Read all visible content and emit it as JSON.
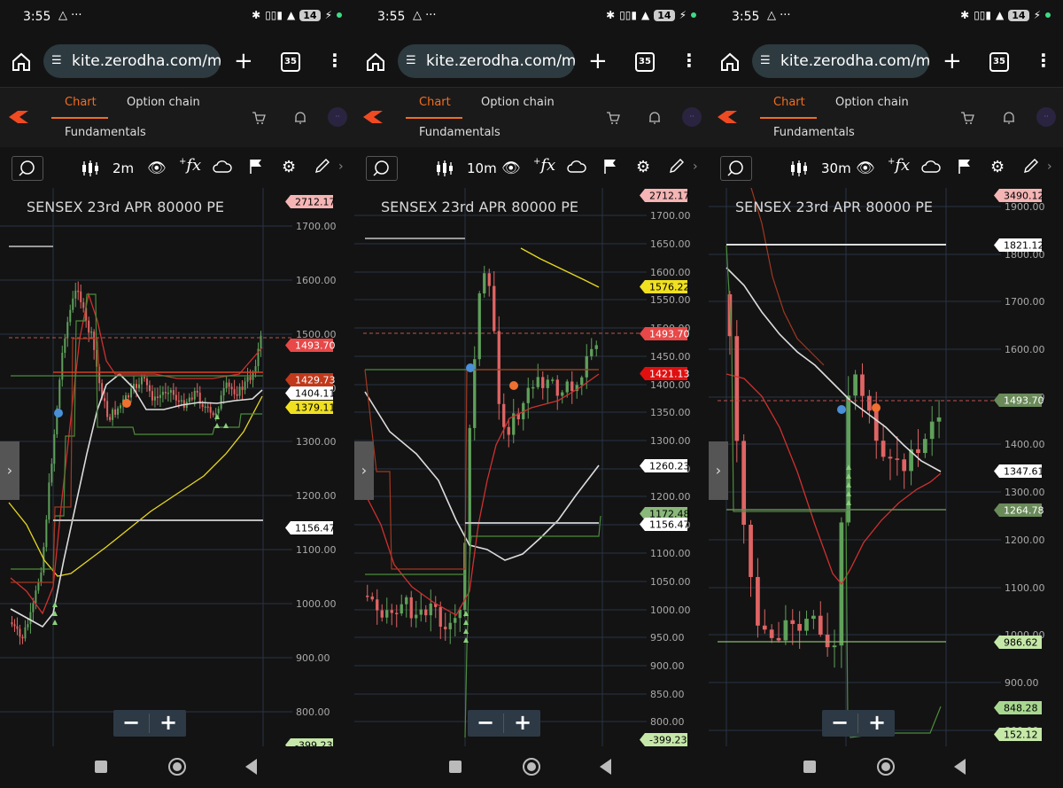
{
  "panels": [
    {
      "status": {
        "time": "3:55",
        "battery": "14"
      },
      "browser": {
        "url": "kite.zerodha.com/mar",
        "tab_count": "35"
      },
      "app_tabs": {
        "chart": "Chart",
        "option_chain": "Option chain",
        "fundamentals": "Fundamentals"
      },
      "avatar_text": "··",
      "toolbar": {
        "interval": "2m"
      },
      "chart_title": "SENSEX 23rd APR 80000 PE",
      "chart_data": {
        "type": "candlestick",
        "title": "SENSEX 23rd APR 80000 PE",
        "interval": "2m",
        "price_axis_ticks": [
          "1700.00",
          "1600.00",
          "1500.00",
          "1400.00",
          "1300.00",
          "1200.00",
          "1100.00",
          "1000.00",
          "900.00",
          "800.00"
        ],
        "price_tags": [
          {
            "label": "2712.17",
            "color": "#f5b5b5",
            "text_color": "#000"
          },
          {
            "label": "1493.70",
            "color": "#e84848",
            "text_color": "#fff"
          },
          {
            "label": "1429.73",
            "color": "#c0391b",
            "text_color": "#fff"
          },
          {
            "label": "1404.11",
            "color": "#ffffff",
            "text_color": "#000"
          },
          {
            "label": "1379.11",
            "color": "#f0e020",
            "text_color": "#000"
          },
          {
            "label": "1156.47",
            "color": "#ffffff",
            "text_color": "#000"
          },
          {
            "label": "-399.23",
            "color": "#c5e8a8",
            "text_color": "#000"
          }
        ],
        "colors": {
          "up": "#5fa05a",
          "down": "#e06464"
        }
      }
    },
    {
      "status": {
        "time": "3:55",
        "battery": "14"
      },
      "browser": {
        "url": "kite.zerodha.com/mar",
        "tab_count": "35"
      },
      "app_tabs": {
        "chart": "Chart",
        "option_chain": "Option chain",
        "fundamentals": "Fundamentals"
      },
      "avatar_text": "··",
      "toolbar": {
        "interval": "10m"
      },
      "chart_title": "SENSEX 23rd APR 80000 PE",
      "chart_data": {
        "type": "candlestick",
        "title": "SENSEX 23rd APR 80000 PE",
        "interval": "10m",
        "price_axis_ticks": [
          "1700.00",
          "1650.00",
          "1600.00",
          "1550.00",
          "1500.00",
          "1450.00",
          "1400.00",
          "1350.00",
          "1300.00",
          "1250.00",
          "1200.00",
          "1150.00",
          "1100.00",
          "1050.00",
          "1000.00",
          "950.00",
          "900.00",
          "850.00",
          "800.00"
        ],
        "price_tags": [
          {
            "label": "2712.17",
            "color": "#f5b5b5",
            "text_color": "#000"
          },
          {
            "label": "1576.22",
            "color": "#f0e020",
            "text_color": "#000"
          },
          {
            "label": "1493.70",
            "color": "#e84848",
            "text_color": "#fff"
          },
          {
            "label": "1421.13",
            "color": "#e01010",
            "text_color": "#fff"
          },
          {
            "label": "1260.23",
            "color": "#ffffff",
            "text_color": "#000"
          },
          {
            "label": "1172.48",
            "color": "#8ab87a",
            "text_color": "#000"
          },
          {
            "label": "1156.47",
            "color": "#ffffff",
            "text_color": "#000"
          },
          {
            "label": "-399.23",
            "color": "#c5e8a8",
            "text_color": "#000"
          }
        ],
        "colors": {
          "up": "#5fa05a",
          "down": "#e06464"
        }
      }
    },
    {
      "status": {
        "time": "3:55",
        "battery": "14"
      },
      "browser": {
        "url": "kite.zerodha.com/mar",
        "tab_count": "35"
      },
      "app_tabs": {
        "chart": "Chart",
        "option_chain": "Option chain",
        "fundamentals": "Fundamentals"
      },
      "avatar_text": "··",
      "toolbar": {
        "interval": "30m"
      },
      "chart_title": "SENSEX 23rd APR 80000 PE",
      "chart_data": {
        "type": "candlestick",
        "title": "SENSEX 23rd APR 80000 PE",
        "interval": "30m",
        "price_axis_ticks": [
          "1900.00",
          "1800.00",
          "1700.00",
          "1600.00",
          "1500.00",
          "1400.00",
          "1300.00",
          "1200.00",
          "1100.00",
          "1000.00",
          "900.00",
          "800.00"
        ],
        "price_tags": [
          {
            "label": "3490.12",
            "color": "#f5b5b5",
            "text_color": "#000"
          },
          {
            "label": "1821.12",
            "color": "#ffffff",
            "text_color": "#000"
          },
          {
            "label": "1493.70",
            "color": "#6a8a5a",
            "text_color": "#fff"
          },
          {
            "label": "1347.61",
            "color": "#ffffff",
            "text_color": "#000"
          },
          {
            "label": "1264.78",
            "color": "#6a8a5a",
            "text_color": "#fff"
          },
          {
            "label": "986.62",
            "color": "#c5e8a8",
            "text_color": "#000"
          },
          {
            "label": "848.28",
            "color": "#a8d890",
            "text_color": "#000"
          },
          {
            "label": "152.12",
            "color": "#c5e8a8",
            "text_color": "#000"
          }
        ],
        "colors": {
          "up": "#5fa05a",
          "down": "#e06464"
        }
      }
    }
  ],
  "icons": [
    "home-icon",
    "site-settings-icon",
    "new-tab-icon",
    "tab-switcher-icon",
    "menu-icon",
    "kite-logo-icon",
    "cart-icon",
    "bell-icon",
    "search-icon",
    "candle-icon",
    "eye-icon",
    "fx-icon",
    "cloud-icon",
    "flag-icon",
    "gear-icon",
    "pen-icon",
    "chevron-right-icon",
    "minus-icon",
    "plus-icon",
    "nav-recents-icon",
    "nav-home-icon",
    "nav-back-icon"
  ]
}
